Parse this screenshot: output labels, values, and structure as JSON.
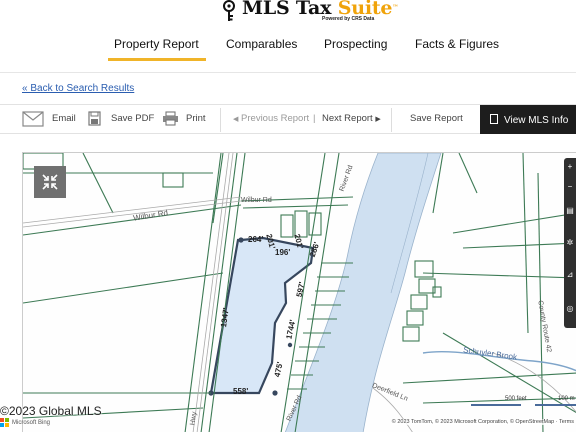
{
  "header": {
    "brand_main": "MLS Tax ",
    "brand_accent": "Suite",
    "brand_tm": "™",
    "brand_sub": "Powered by CRS Data"
  },
  "nav": {
    "tabs": [
      {
        "label": "Property Report",
        "active": true
      },
      {
        "label": "Comparables",
        "active": false
      },
      {
        "label": "Prospecting",
        "active": false
      },
      {
        "label": "Facts & Figures",
        "active": false
      }
    ]
  },
  "back_link": "« Back to Search Results",
  "toolbar": {
    "email": "Email",
    "save_pdf": "Save PDF",
    "print": "Print",
    "previous_report": "Previous Report",
    "separator": "|",
    "next_report": "Next Report",
    "save_report": "Save Report",
    "view_mls": "View MLS Info"
  },
  "map": {
    "roads": {
      "wilbur_rd_left": "Wilbur Rd",
      "wilbur_rd_top": "Wilbur Rd",
      "river_rd_top": "River Rd",
      "river_rd_bottom": "River Rd",
      "deerfield_ln": "Deerfield Ln",
      "schuyler_brook": "Schuyler Brook",
      "county_route": "County Route 42",
      "highway": "Hwy"
    },
    "dimensions": {
      "top": "264'",
      "inner_top": "196'",
      "inner_a": "201'",
      "inner_b": "201'",
      "right_top": "286'",
      "right_mid": "597'",
      "right_low": "1744'",
      "right_bottom": "475'",
      "left": "1347'",
      "bottom": "558'"
    },
    "watermark": "©2023 Global MLS",
    "microsoft": "Microsoft Bing",
    "scale_feet": "500 feet",
    "scale_m": "100 m",
    "attribution": "© 2023 TomTom, © 2023 Microsoft Corporation, © OpenStreetMap · Terms",
    "colors": {
      "water": "#cfe0f1",
      "parcel": "#d8e7f7",
      "parcel_line": "#37475e",
      "lot_lines": "#3d7a55"
    }
  }
}
